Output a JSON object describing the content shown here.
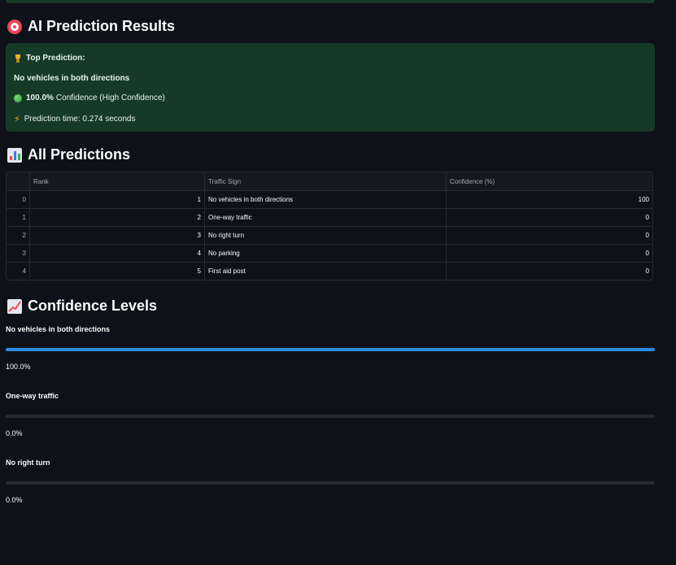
{
  "results": {
    "title": "AI Prediction Results",
    "top_label": "Top Prediction:",
    "top_prediction": "No vehicles in both directions",
    "confidence_value": "100.0%",
    "confidence_text": "Confidence (High Confidence)",
    "prediction_time": "Prediction time: 0.274 seconds"
  },
  "all_predictions": {
    "title": "All Predictions",
    "columns": [
      "",
      "Rank",
      "Traffic Sign",
      "Confidence (%)"
    ],
    "rows": [
      {
        "index": "0",
        "rank": "1",
        "sign": "No vehicles in both directions",
        "confidence": "100"
      },
      {
        "index": "1",
        "rank": "2",
        "sign": "One-way traffic",
        "confidence": "0"
      },
      {
        "index": "2",
        "rank": "3",
        "sign": "No right turn",
        "confidence": "0"
      },
      {
        "index": "3",
        "rank": "4",
        "sign": "No parking",
        "confidence": "0"
      },
      {
        "index": "4",
        "rank": "5",
        "sign": "First aid post",
        "confidence": "0"
      }
    ]
  },
  "confidence_levels": {
    "title": "Confidence Levels",
    "items": [
      {
        "label": "No vehicles in both directions",
        "value_text": "100.0%",
        "fraction": 1.0
      },
      {
        "label": "One-way traffic",
        "value_text": "0.0%",
        "fraction": 0.0
      },
      {
        "label": "No right turn",
        "value_text": "0.0%",
        "fraction": 0.0
      }
    ]
  },
  "colors": {
    "background": "#0e1117",
    "success_bg": "#173928",
    "progress_fill": "#2b8ae2",
    "progress_track": "#262a33"
  },
  "icons": {
    "results": "direct-hit-target-icon",
    "top": "trophy-icon",
    "confidence": "green-circle-icon",
    "time": "lightning-bolt-icon",
    "all_predictions": "bar-chart-icon",
    "confidence_levels": "chart-increasing-icon"
  }
}
